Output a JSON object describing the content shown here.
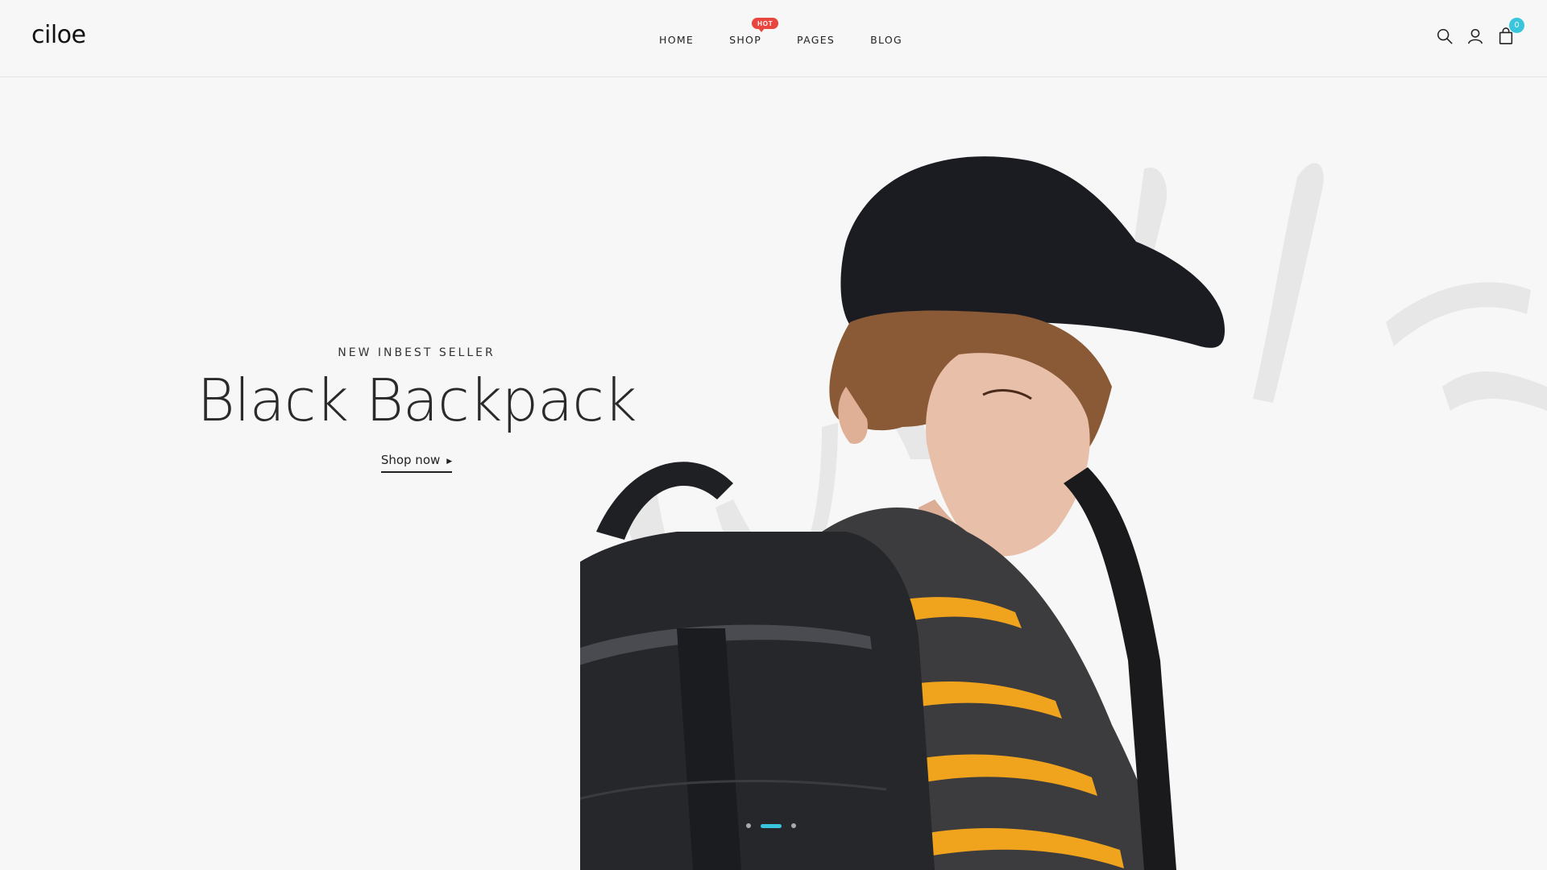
{
  "brand": {
    "logo": "ciloe"
  },
  "nav": {
    "items": [
      {
        "label": "HOME"
      },
      {
        "label": "SHOP",
        "badge": "HOT"
      },
      {
        "label": "PAGES"
      },
      {
        "label": "BLOG"
      }
    ]
  },
  "header_icons": {
    "search": "search-icon",
    "account": "user-icon",
    "cart": "shopping-bag-icon",
    "cart_count": "0"
  },
  "hero": {
    "subtitle": "NEW INBEST SELLER",
    "title": "Black Backpack",
    "cta": "Shop now",
    "slide_count": 3,
    "active_slide": 2
  },
  "colors": {
    "accent": "#39c5dc",
    "hot_badge": "#e8463f",
    "background": "#f7f7f7",
    "text": "#222222"
  }
}
